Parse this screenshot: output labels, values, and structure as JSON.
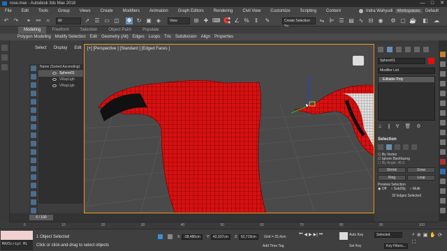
{
  "window": {
    "title": "rose.max - Autodesk 3ds Max 2018",
    "controls": [
      "—",
      "□",
      "✕"
    ]
  },
  "menubar": {
    "items": [
      "File",
      "Edit",
      "Tools",
      "Group",
      "Views",
      "Create",
      "Modifiers",
      "Animation",
      "Graph Editors",
      "Rendering",
      "Civil View",
      "Customize",
      "Scripting",
      "Content"
    ],
    "user": "Indra Wahyudi",
    "workspaces_label": "Workspaces:",
    "workspace_value": "Default"
  },
  "toolbar": {
    "filter_value": "All",
    "view_value": "View",
    "selection_set_placeholder": "Create Selection Se"
  },
  "ribbon": {
    "tabs": [
      "Modeling",
      "Freeform",
      "Selection",
      "Object Paint",
      "Populate"
    ],
    "active_tab": "Modeling",
    "sub_items": [
      "Polygon Modeling",
      "Modify Selection",
      "Edit",
      "Geometry (All)",
      "Edges",
      "Loops",
      "Tris",
      "Subdivision",
      "Align",
      "Properties"
    ]
  },
  "scene_explorer": {
    "menu": [
      "Select",
      "Display",
      "Edit"
    ],
    "header": "Name (Sorted Ascending)",
    "rows": [
      {
        "name": "Sphere01",
        "selected": true
      },
      {
        "name": "VRayLigh",
        "selected": false
      },
      {
        "name": "VRayLigh",
        "selected": false
      }
    ]
  },
  "viewport": {
    "label": "[+] [Perspective ] [Standard ] [Edged Faces ]",
    "mesh_color": "#e01010",
    "bg_color": "#4a4a4a",
    "active_border_color": "#f0a020"
  },
  "command_panel": {
    "object_name": "Sphere01",
    "object_color": "#e01010",
    "modifier_list_label": "Modifier List",
    "stack": [
      "Editable Poly"
    ],
    "selection_title": "Selection",
    "by_vertex": "By Vertex",
    "ignore_backfacing": "Ignore Backfacing",
    "by_angle_label": "By Angle:",
    "by_angle_value": "45.0",
    "shrink": "Shrink",
    "grow": "Grow",
    "ring": "Ring",
    "loop": "Loop",
    "preview_selection": "Preview Selection",
    "preview_options": [
      "Off",
      "SubObj",
      "Multi"
    ],
    "preview_selected": "Off",
    "selected_count": "32 Edges Selected"
  },
  "timeline": {
    "slider_label": "0 / 100",
    "ticks": [
      "0",
      "10",
      "20",
      "30",
      "40",
      "50",
      "60",
      "70",
      "80",
      "90",
      "100"
    ]
  },
  "status": {
    "line1": "1 Object Selected",
    "line2": "Click or click-and-drag to select objects",
    "x_label": "X:",
    "x_value": "-38,486cm",
    "y_label": "Y:",
    "y_value": "42,337cm",
    "z_label": "Z:",
    "z_value": "52,719cm",
    "grid": "Grid = 25,4cm",
    "add_time_tag": "Add Time Tag",
    "auto_key": "Auto Key",
    "set_key": "Set Key",
    "key_filter_value": "Selected",
    "key_filters": "Key Filters...",
    "maxscript": "MAXScript Mi"
  }
}
